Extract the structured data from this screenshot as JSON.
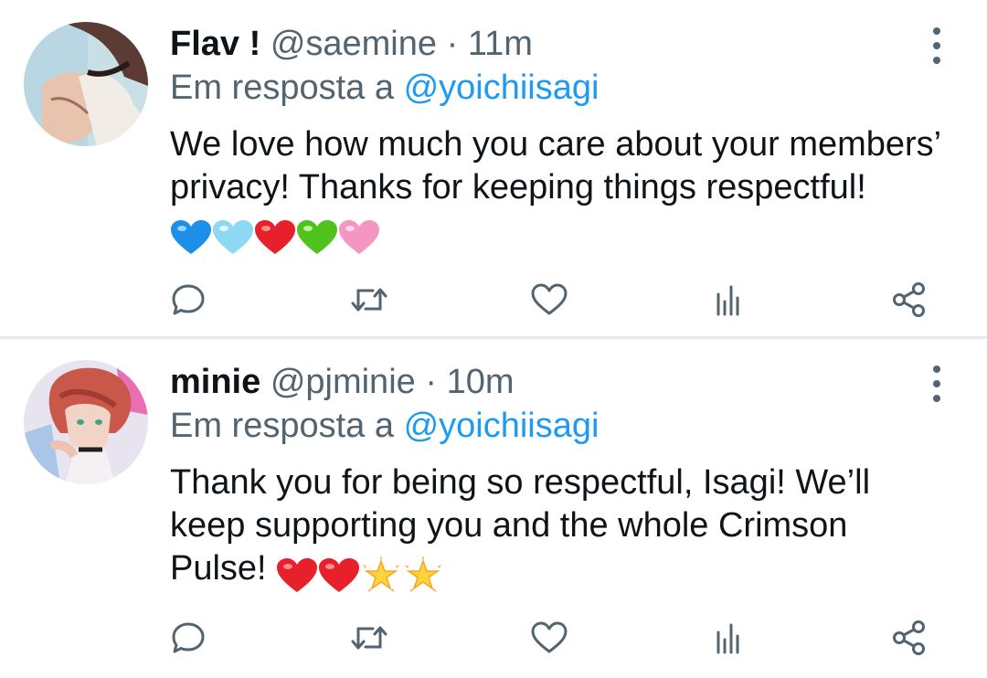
{
  "tweets": [
    {
      "name": "Flav !",
      "handle": "@saemine",
      "separator": "·",
      "time": "11m",
      "reply_prefix": "Em resposta a",
      "reply_to": "@yoichiisagi",
      "text": "We love how much you care about your members’ privacy! Thanks for keeping things respectful!",
      "emojis": [
        "blue-heart",
        "light-blue-heart",
        "red-heart",
        "green-heart",
        "pink-heart"
      ]
    },
    {
      "name": "minie",
      "handle": "@pjminie",
      "separator": "·",
      "time": "10m",
      "reply_prefix": "Em resposta a",
      "reply_to": "@yoichiisagi",
      "text": "Thank you for being so respectful, Isagi! We’ll keep supporting you and the whole Crimson Pulse!",
      "emojis": [
        "red-heart",
        "red-heart",
        "glowing-star",
        "glowing-star"
      ]
    }
  ],
  "actions": [
    "reply-icon",
    "retweet-icon",
    "like-icon",
    "analytics-icon",
    "share-icon"
  ],
  "colors": {
    "text": "#0f1419",
    "secondary": "#536471",
    "mention": "#1d9bf0",
    "divider": "#e7eaed"
  }
}
